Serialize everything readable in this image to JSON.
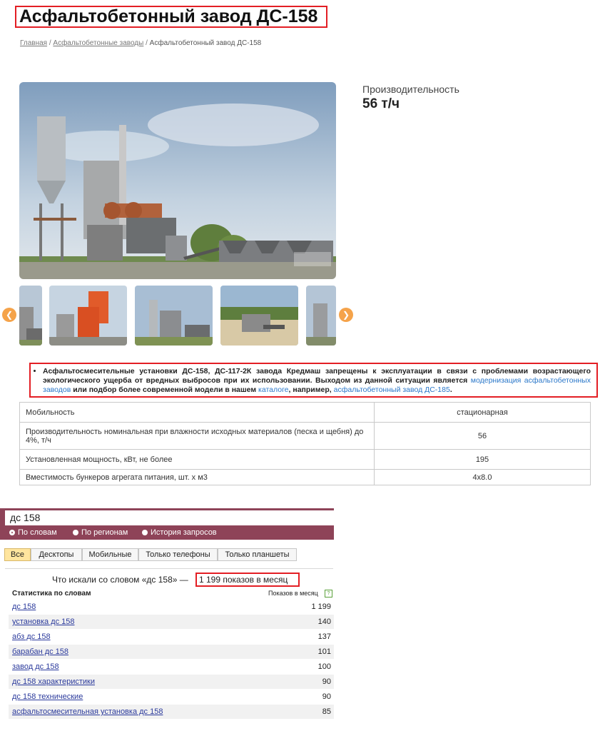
{
  "title": "Асфальтобетонный завод ДС-158",
  "breadcrumb": {
    "home": "Главная",
    "separator": "/",
    "category": "Асфальтобетонные заводы",
    "current": "Асфальтобетонный завод ДС-158"
  },
  "productivity": {
    "label": "Производительность",
    "value": "56 т/ч"
  },
  "gallery": {
    "prev_icon": "chevron-left-icon",
    "next_icon": "chevron-right-icon"
  },
  "notice": {
    "part1": "Асфальтосмесительные установки ДС-158, ДС-117-2К завода Кредмаш запрещены к эксплуатации в связи с проблемами возрастающего экологического ущерба от вредных выбросов при их использовании. Выходом из данной ситуации является ",
    "link1": "модернизация асфальтобетонных заводов",
    "part2": " или подбор более современной модели в нашем ",
    "link2": "каталоге",
    "part3": ", например, ",
    "link3": "асфальтобетонный завод ДС-185",
    "part4": "."
  },
  "specs": [
    {
      "name": "Мобильность",
      "value": "стационарная"
    },
    {
      "name": "Производительность номинальная при влажности исходных материалов (песка и щебня) до 4%, т/ч",
      "value": "56"
    },
    {
      "name": "Установленная мощность, кВт, не более",
      "value": "195"
    },
    {
      "name": "Вместимость бункеров агрегата питания, шт. х м3",
      "value": "4х8.0"
    }
  ],
  "wordstat": {
    "query": "дс 158",
    "radios": [
      "По словам",
      "По регионам",
      "История запросов"
    ],
    "tabs": [
      "Все",
      "Десктопы",
      "Мобильные",
      "Только телефоны",
      "Только планшеты"
    ],
    "summary_prefix": "Что искали со словом «дс 158» —",
    "summary_count": "1 199 показов в месяц",
    "col_left": "Статистика по словам",
    "col_right": "Показов в месяц",
    "help_icon": "?",
    "rows": [
      {
        "phrase": "дс 158",
        "count": "1 199"
      },
      {
        "phrase": "установка дс 158",
        "count": "140"
      },
      {
        "phrase": "абз дс 158",
        "count": "137"
      },
      {
        "phrase": "барабан дс 158",
        "count": "101"
      },
      {
        "phrase": "завод дс 158",
        "count": "100"
      },
      {
        "phrase": "дс 158 характеристики",
        "count": "90"
      },
      {
        "phrase": "дс 158 технические",
        "count": "90"
      },
      {
        "phrase": "асфальтосмесительная установка дс 158",
        "count": "85"
      }
    ]
  },
  "colors": {
    "accent_red": "#e31e24",
    "wordstat_panel": "#8e4358",
    "link_blue": "#2a77c9",
    "arrow_orange": "#f5a34a"
  }
}
